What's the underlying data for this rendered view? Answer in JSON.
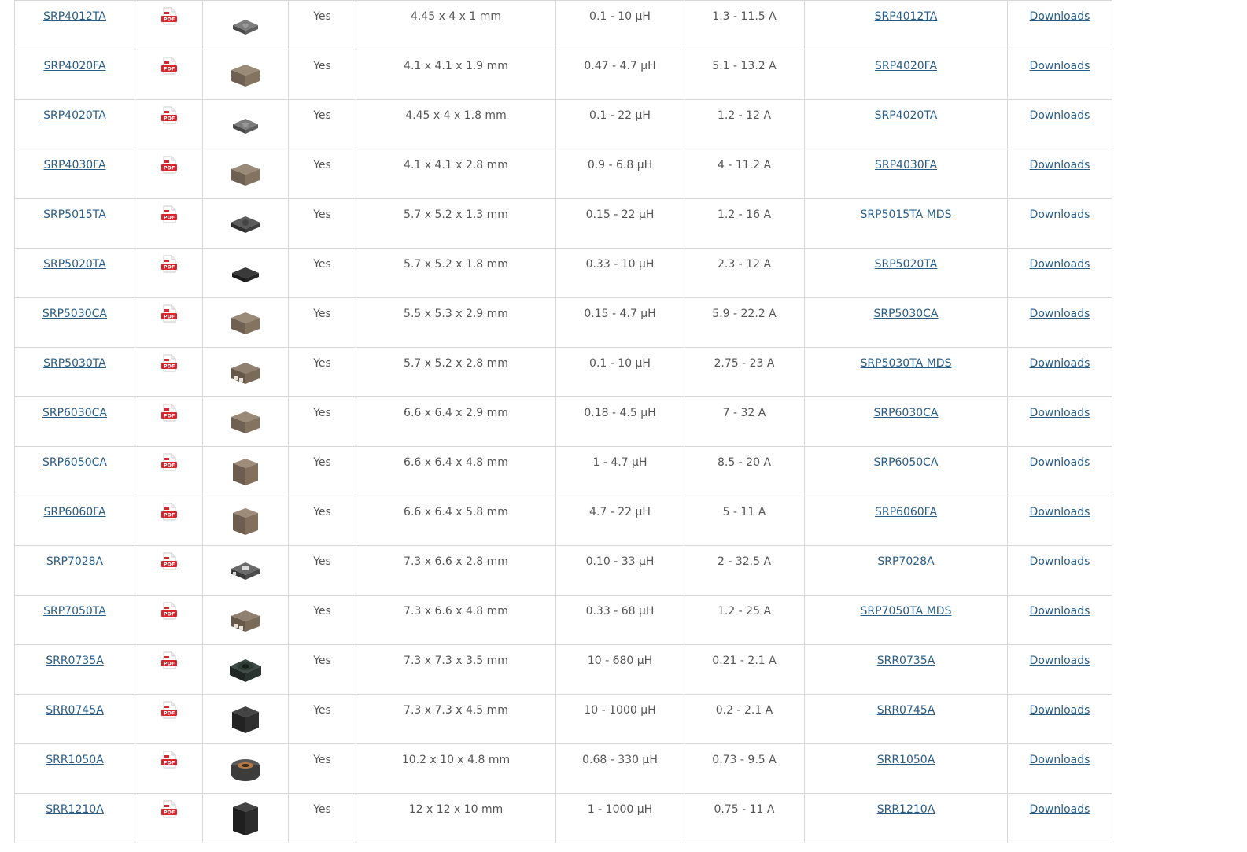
{
  "table": {
    "rows": [
      {
        "part": "SRP4012TA",
        "icon": "pdf-icon",
        "photo": "flat-grey",
        "aec": "Yes",
        "size": "4.45 x 4 x 1 mm",
        "inductance": "0.1 - 10 µH",
        "current": "1.3 - 11.5 A",
        "model": "SRP4012TA",
        "downloads": "Downloads"
      },
      {
        "part": "SRP4020FA",
        "icon": "pdf-icon",
        "photo": "brown-block",
        "aec": "Yes",
        "size": "4.1 x 4.1 x 1.9 mm",
        "inductance": "0.47 - 4.7 µH",
        "current": "5.1 - 13.2 A",
        "model": "SRP4020FA",
        "downloads": "Downloads"
      },
      {
        "part": "SRP4020TA",
        "icon": "pdf-icon",
        "photo": "flat-grey",
        "aec": "Yes",
        "size": "4.45 x 4 x 1.8 mm",
        "inductance": "0.1 - 22 µH",
        "current": "1.2 - 12 A",
        "model": "SRP4020TA",
        "downloads": "Downloads"
      },
      {
        "part": "SRP4030FA",
        "icon": "pdf-icon",
        "photo": "brown-block",
        "aec": "Yes",
        "size": "4.1 x 4.1 x 2.8 mm",
        "inductance": "0.9 - 6.8 µH",
        "current": "4 - 11.2 A",
        "model": "SRP4030FA",
        "downloads": "Downloads"
      },
      {
        "part": "SRP5015TA",
        "icon": "pdf-icon",
        "photo": "dark-flat",
        "aec": "Yes",
        "size": "5.7 x 5.2 x 1.3 mm",
        "inductance": "0.15 - 22 µH",
        "current": "1.2 - 16 A",
        "model": "SRP5015TA MDS",
        "downloads": "Downloads"
      },
      {
        "part": "SRP5020TA",
        "icon": "pdf-icon",
        "photo": "black-flat",
        "aec": "Yes",
        "size": "5.7 x 5.2 x 1.8 mm",
        "inductance": "0.33 - 10 µH",
        "current": "2.3 - 12 A",
        "model": "SRP5020TA",
        "downloads": "Downloads"
      },
      {
        "part": "SRP5030CA",
        "icon": "pdf-icon",
        "photo": "brown-block",
        "aec": "Yes",
        "size": "5.5 x 5.3 x 2.9 mm",
        "inductance": "0.15 - 4.7 µH",
        "current": "5.9 - 22.2 A",
        "model": "SRP5030CA",
        "downloads": "Downloads"
      },
      {
        "part": "SRP5030TA",
        "icon": "pdf-icon",
        "photo": "brown-terminal",
        "aec": "Yes",
        "size": "5.7 x 5.2 x 2.8 mm",
        "inductance": "0.1 - 10 µH",
        "current": "2.75 - 23 A",
        "model": "SRP5030TA MDS",
        "downloads": "Downloads"
      },
      {
        "part": "SRP6030CA",
        "icon": "pdf-icon",
        "photo": "brown-block",
        "aec": "Yes",
        "size": "6.6 x 6.4 x 2.9 mm",
        "inductance": "0.18 - 4.5 µH",
        "current": "7 - 32 A",
        "model": "SRP6030CA",
        "downloads": "Downloads"
      },
      {
        "part": "SRP6050CA",
        "icon": "pdf-icon",
        "photo": "brown-cube",
        "aec": "Yes",
        "size": "6.6 x 6.4 x 4.8 mm",
        "inductance": "1 - 4.7 µH",
        "current": "8.5 - 20 A",
        "model": "SRP6050CA",
        "downloads": "Downloads"
      },
      {
        "part": "SRP6060FA",
        "icon": "pdf-icon",
        "photo": "brown-cube",
        "aec": "Yes",
        "size": "6.6 x 6.4 x 5.8 mm",
        "inductance": "4.7 - 22 µH",
        "current": "5 - 11 A",
        "model": "SRP6060FA",
        "downloads": "Downloads"
      },
      {
        "part": "SRP7028A",
        "icon": "pdf-icon",
        "photo": "grey-marked",
        "aec": "Yes",
        "size": "7.3 x 6.6 x 2.8 mm",
        "inductance": "0.10 - 33 µH",
        "current": "2 - 32.5 A",
        "model": "SRP7028A",
        "downloads": "Downloads"
      },
      {
        "part": "SRP7050TA",
        "icon": "pdf-icon",
        "photo": "brown-terminal",
        "aec": "Yes",
        "size": "7.3 x 6.6 x 4.8 mm",
        "inductance": "0.33 - 68 µH",
        "current": "1.2 - 25 A",
        "model": "SRP7050TA MDS",
        "downloads": "Downloads"
      },
      {
        "part": "SRR0735A",
        "icon": "pdf-icon",
        "photo": "coil-green",
        "aec": "Yes",
        "size": "7.3 x 7.3 x 3.5 mm",
        "inductance": "10 - 680 µH",
        "current": "0.21 - 2.1 A",
        "model": "SRR0735A",
        "downloads": "Downloads"
      },
      {
        "part": "SRR0745A",
        "icon": "pdf-icon",
        "photo": "black-shield",
        "aec": "Yes",
        "size": "7.3 x 7.3 x 4.5 mm",
        "inductance": "10 - 1000 µH",
        "current": "0.2 - 2.1 A",
        "model": "SRR0745A",
        "downloads": "Downloads"
      },
      {
        "part": "SRR1050A",
        "icon": "pdf-icon",
        "photo": "coil-copper",
        "aec": "Yes",
        "size": "10.2 x 10 x 4.8 mm",
        "inductance": "0.68 - 330 µH",
        "current": "0.73 - 9.5 A",
        "model": "SRR1050A",
        "downloads": "Downloads"
      },
      {
        "part": "SRR1210A",
        "icon": "pdf-icon",
        "photo": "black-tall",
        "aec": "Yes",
        "size": "12 x 12 x 10 mm",
        "inductance": "1 - 1000 µH",
        "current": "0.75 - 11 A",
        "model": "SRR1210A",
        "downloads": "Downloads"
      }
    ]
  },
  "colors": {
    "link": "#2a5d86",
    "text": "#555555",
    "border": "#d7d7d7",
    "pdf_red": "#d9262c"
  }
}
